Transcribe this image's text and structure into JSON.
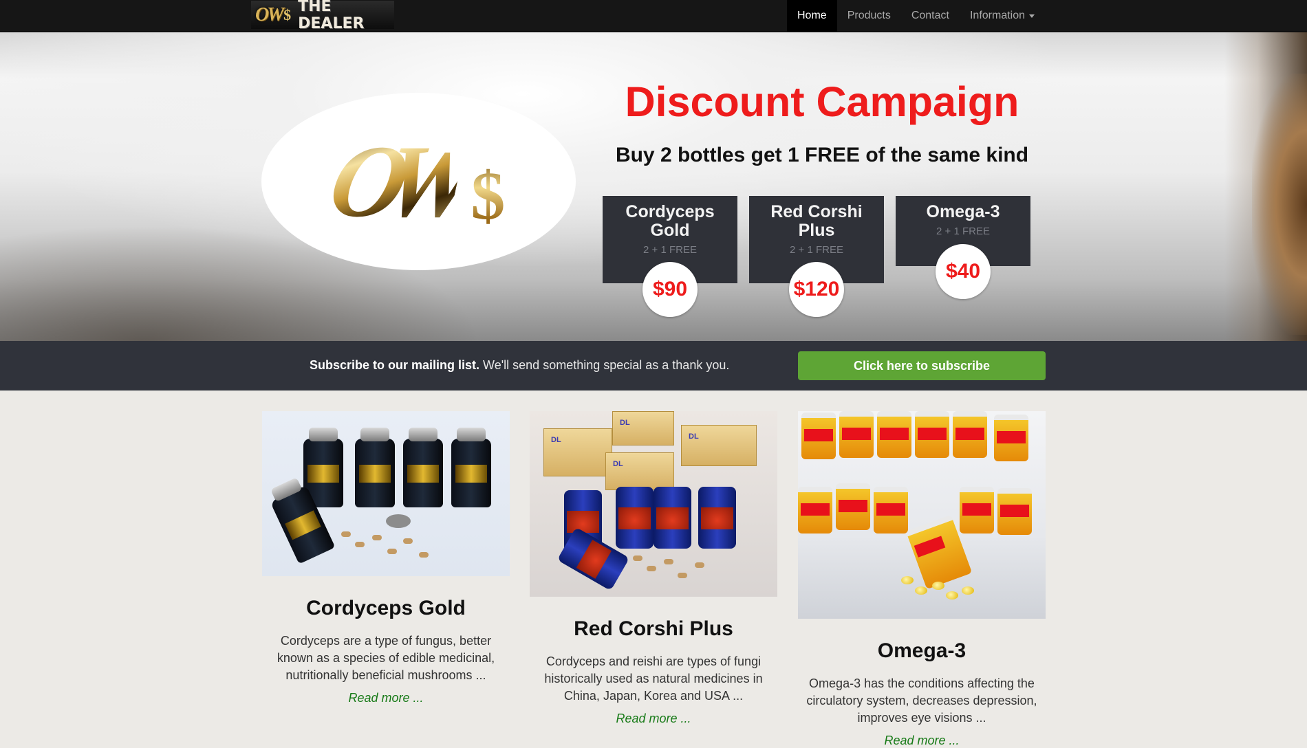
{
  "nav": {
    "brand_name": "THE DEALER",
    "brand_mark": "OW",
    "brand_dollar": "$",
    "items": [
      {
        "label": "Home",
        "active": true
      },
      {
        "label": "Products",
        "active": false
      },
      {
        "label": "Contact",
        "active": false
      },
      {
        "label": "Information",
        "active": false,
        "dropdown": true
      }
    ]
  },
  "hero": {
    "logo_mark": "OW",
    "logo_dollar": "$",
    "title": "Discount Campaign",
    "subtitle": "Buy 2 bottles get 1 FREE of the same kind",
    "title_color": "#ee1c1c",
    "offers": [
      {
        "name": "Cordyceps Gold",
        "deal": "2 + 1 FREE",
        "price": "$90"
      },
      {
        "name": "Red Corshi Plus",
        "deal": "2 + 1 FREE",
        "price": "$120"
      },
      {
        "name": "Omega-3",
        "deal": "2 + 1 FREE",
        "price": "$40"
      }
    ]
  },
  "subscribe": {
    "lead": "Subscribe to our mailing list.",
    "text": " We'll send something special as a thank you.",
    "button": "Click here to subscribe",
    "button_color": "#5ea535"
  },
  "products": [
    {
      "title": "Cordyceps Gold",
      "description": "Cordyceps are a type of fungus, better known as a species of edible medicinal, nutritionally beneficial mushrooms ...",
      "more": "Read more ..."
    },
    {
      "title": "Red Corshi Plus",
      "description": "Cordyceps and reishi are types of fungi historically used as natural medicines in China, Japan, Korea and USA ...",
      "more": "Read more ..."
    },
    {
      "title": "Omega-3",
      "description": "Omega-3 has the conditions affecting the circulatory system, decreases depression, improves eye visions ...",
      "more": "Read more ..."
    }
  ]
}
